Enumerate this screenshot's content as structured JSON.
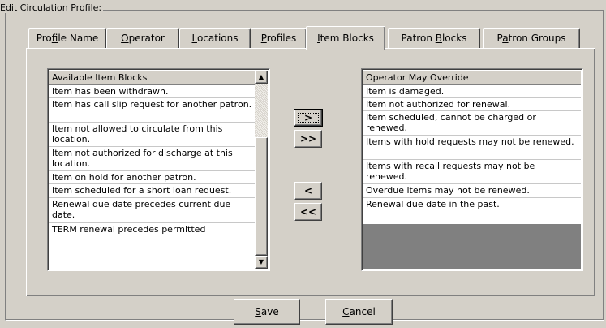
{
  "group_title": "Edit  Circulation Profile:",
  "tabs": [
    {
      "pre": "Pro",
      "u": "f",
      "post": "ile Name"
    },
    {
      "pre": "",
      "u": "O",
      "post": "perator"
    },
    {
      "pre": "",
      "u": "L",
      "post": "ocations"
    },
    {
      "pre": "",
      "u": "P",
      "post": "rofiles"
    },
    {
      "pre": "",
      "u": "I",
      "post": "tem Blocks"
    },
    {
      "pre": "Patron ",
      "u": "B",
      "post": "locks"
    },
    {
      "pre": "P",
      "u": "a",
      "post": "tron Groups"
    }
  ],
  "active_tab": "Item Blocks",
  "available": {
    "header": "Available Item Blocks",
    "items": [
      "Item has been withdrawn.",
      "Item has call slip request for another patron.",
      "Item not allowed to circulate from this location.",
      "Item not authorized for discharge at this location.",
      "Item on hold for another patron.",
      "Item scheduled for a short loan request.",
      "Renewal due date precedes current due date.",
      "TERM renewal precedes permitted"
    ]
  },
  "override": {
    "header": "Operator May Override",
    "items": [
      "Item is damaged.",
      "Item not authorized for renewal.",
      "Item scheduled, cannot be charged or renewed.",
      "Items with hold requests may not be renewed.",
      "Items with recall requests may not be renewed.",
      "Overdue items may not be renewed.",
      "Renewal due date in the past."
    ]
  },
  "move_buttons": {
    "add_one": ">",
    "add_all": ">>",
    "remove_one": "<",
    "remove_all": "<<"
  },
  "save": {
    "u": "S",
    "post": "ave"
  },
  "cancel": {
    "u": "C",
    "post": "ancel"
  },
  "scroll_icons": {
    "up": "arrow-up",
    "down": "arrow-down"
  }
}
